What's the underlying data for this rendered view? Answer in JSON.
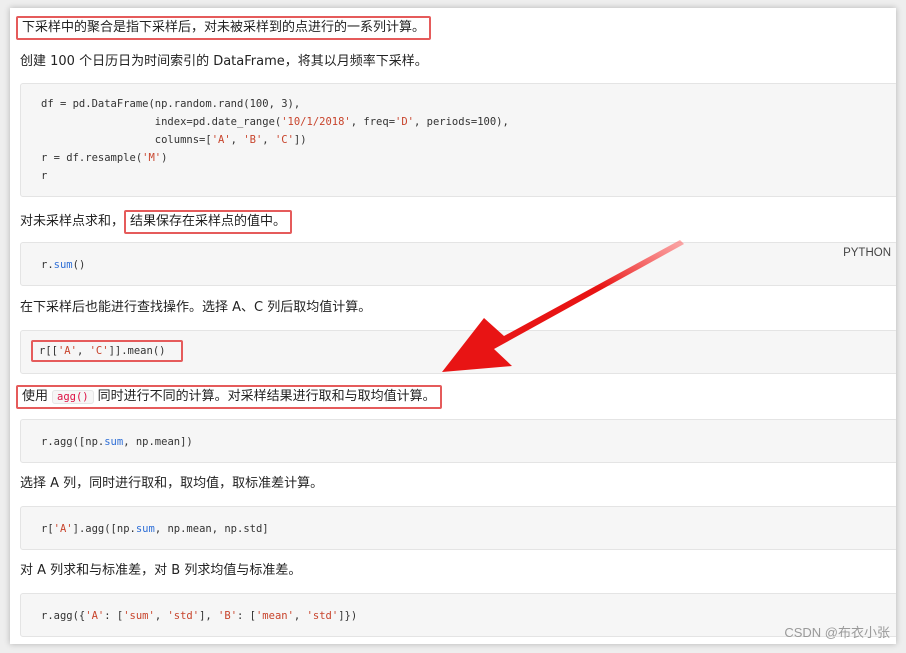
{
  "paragraphs": {
    "p1": "下采样中的聚合是指下采样后，对未被采样到的点进行的一系列计算。",
    "p2": "创建 100 个日历日为时间索引的 DataFrame，将其以月频率下采样。",
    "p3_prefix": "对未采样点求和，",
    "p3_highlight": "结果保存在采样点的值中。",
    "p4": "在下采样后也能进行查找操作。选择 A、C 列后取均值计算。",
    "p5_prefix": "使用",
    "p5_code": "agg()",
    "p5_suffix": "同时进行不同的计算。对采样结果进行取和与取均值计算。",
    "p6": "选择 A 列，同时进行取和，取均值，取标准差计算。",
    "p7": "对 A 列求和与标准差，对 B 列求均值与标准差。"
  },
  "code": {
    "block1": {
      "l1_a": "df = pd.DataFrame(np.random.rand(100, 3),",
      "l2_a": "                  index=pd.date_range(",
      "l2_s1": "'10/1/2018'",
      "l2_b": ", freq=",
      "l2_s2": "'D'",
      "l2_c": ", periods=100),",
      "l3_a": "                  columns=[",
      "l3_s1": "'A'",
      "l3_b": ", ",
      "l3_s2": "'B'",
      "l3_c": ", ",
      "l3_s3": "'C'",
      "l3_d": "])",
      "l4_a": "r = df.resample(",
      "l4_s1": "'M'",
      "l4_b": ")",
      "l5_a": "r"
    },
    "block2": {
      "a": "r.",
      "fn": "sum",
      "b": "()",
      "lang": "PYTHON"
    },
    "block3": {
      "a": "r[[",
      "s1": "'A'",
      "b": ", ",
      "s2": "'C'",
      "c": "]].mean()"
    },
    "block4": {
      "a": "r.agg([np.",
      "fn": "sum",
      "b": ", np.mean])"
    },
    "block5": {
      "a": "r[",
      "s1": "'A'",
      "b": "].agg([np.",
      "fn": "sum",
      "c": ", np.mean, np.std]"
    },
    "block6": {
      "a": "r.agg({",
      "s1": "'A'",
      "b": ": [",
      "s2": "'sum'",
      "c": ", ",
      "s3": "'std'",
      "d": "], ",
      "s4": "'B'",
      "e": ": [",
      "s5": "'mean'",
      "f": ", ",
      "s6": "'std'",
      "g": "]})"
    }
  },
  "watermark": "CSDN @布衣小张",
  "colors": {
    "highlight_box": "#e55b5b",
    "arrow": "#e81414",
    "string": "#c8442c",
    "function": "#2f6fd6"
  }
}
